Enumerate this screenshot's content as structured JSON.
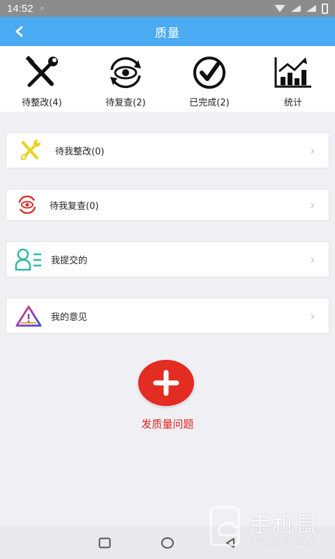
{
  "status_bar": {
    "time": "14:52"
  },
  "header": {
    "title": "质量",
    "back_icon": "chevron-left-icon"
  },
  "quick_actions": [
    {
      "label": "待整改(4)",
      "icon": "tools-icon"
    },
    {
      "label": "待复查(2)",
      "icon": "eye-refresh-icon"
    },
    {
      "label": "已完成(2)",
      "icon": "check-circle-icon"
    },
    {
      "label": "统计",
      "icon": "chart-icon"
    }
  ],
  "list": [
    {
      "label": "待我整改(0)",
      "icon": "tools-icon"
    },
    {
      "label": "待我复查(0)",
      "icon": "eye-refresh-icon"
    },
    {
      "label": "我提交的",
      "icon": "user-list-icon"
    },
    {
      "label": "我的意见",
      "icon": "warning-triangle-icon"
    }
  ],
  "fab": {
    "label": "发质量问题",
    "icon": "plus-icon"
  },
  "watermark": {
    "big": "手机鼠",
    "small": "SHOUJISHU.COM"
  },
  "colors": {
    "header": "#4aaaf2",
    "accent_red": "#e32c22"
  }
}
